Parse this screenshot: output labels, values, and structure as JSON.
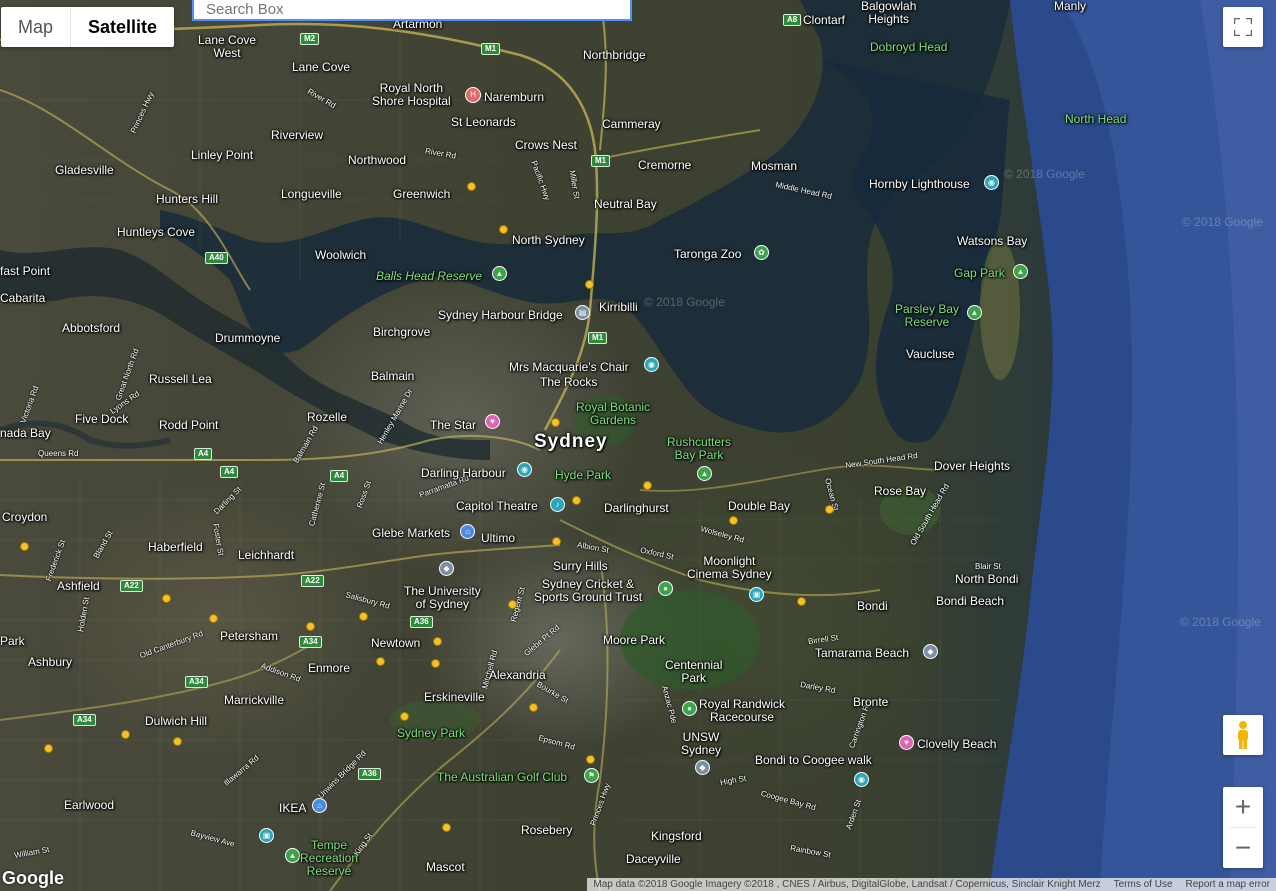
{
  "search": {
    "placeholder": "Search Box"
  },
  "map_type": {
    "options": [
      "Map",
      "Satellite"
    ],
    "selected": "Satellite"
  },
  "controls": {
    "fullscreen_icon": "fullscreen-icon",
    "pegman_icon": "pegman-icon",
    "zoom_in": "+",
    "zoom_out": "−"
  },
  "branding": {
    "logo": "Google"
  },
  "attribution": {
    "map_data": "Map data ©2018 Google Imagery ©2018 , CNES / Airbus, DigitalGlobe, Landsat / Copernicus, Sinclair Knight Merz",
    "terms": "Terms of Use",
    "report": "Report a map error"
  },
  "watermarks": [
    "© 2018 Google",
    "© 2018 Google",
    "© 2018 Google",
    "© 2018 Google"
  ],
  "places": {
    "sydney": "Sydney",
    "artarmon": "Artarmon",
    "lane_cove_west": "Lane Cove\nWest",
    "lane_cove": "Lane Cove",
    "royal_north_shore": "Royal North\nShore Hospital",
    "naremburn": "Naremburn",
    "northbridge": "Northbridge",
    "balgowlah_heights": "Balgowlah\nHeights",
    "clontarf": "Clontarf",
    "manly": "Manly",
    "dobroyd_head": "Dobroyd Head",
    "north_head": "North Head",
    "gladesville": "Gladesville",
    "riverview": "Riverview",
    "linley_point": "Linley Point",
    "st_leonards": "St Leonards",
    "crows_nest": "Crows Nest",
    "cammeray": "Cammeray",
    "cremorne": "Cremorne",
    "mosman": "Mosman",
    "northwood": "Northwood",
    "hunters_hill": "Hunters Hill",
    "longueville": "Longueville",
    "greenwich": "Greenwich",
    "neutral_bay": "Neutral Bay",
    "hornby_lighthouse": "Hornby Lighthouse",
    "huntleys_cove": "Huntleys Cove",
    "north_sydney": "North Sydney",
    "taronga_zoo": "Taronga Zoo",
    "watsons_bay": "Watsons Bay",
    "woolwich": "Woolwich",
    "balls_head": "Balls Head Reserve",
    "gap_park": "Gap Park",
    "fast_point": "fast Point",
    "cabarita": "Cabarita",
    "abbotsford": "Abbotsford",
    "sydney_harbour_bridge": "Sydney Harbour Bridge",
    "kirribilli": "Kirribilli",
    "parsley_bay": "Parsley Bay\nReserve",
    "drummoyne": "Drummoyne",
    "birchgrove": "Birchgrove",
    "vaucluse": "Vaucluse",
    "russell_lea": "Russell Lea",
    "balmain": "Balmain",
    "mrs_macquaries": "Mrs Macquarie's Chair",
    "the_rocks": "The Rocks",
    "five_dock": "Five Dock",
    "royal_botanic": "Royal Botanic\nGardens",
    "rozelle": "Rozelle",
    "rodd_point": "Rodd Point",
    "the_star": "The Star",
    "canada_bay": "nada Bay",
    "rushcutters": "Rushcutters\nBay Park",
    "dover_heights": "Dover Heights",
    "darling_harbour": "Darling Harbour",
    "hyde_park": "Hyde Park",
    "rose_bay": "Rose Bay",
    "capitol_theatre": "Capitol Theatre",
    "darlinghurst": "Darlinghurst",
    "double_bay": "Double Bay",
    "croydon": "Croydon",
    "haberfield": "Haberfield",
    "glebe_markets": "Glebe Markets",
    "ultimo": "Ultimo",
    "leichhardt": "Leichhardt",
    "moonlight_cinema": "Moonlight\nCinema Sydney",
    "surry_hills": "Surry Hills",
    "north_bondi": "North Bondi",
    "sydney_cricket": "Sydney Cricket &\nSports Ground Trust",
    "ashfield": "Ashfield",
    "university_sydney": "The University\nof Sydney",
    "bondi": "Bondi",
    "bondi_beach": "Bondi Beach",
    "park": "Park",
    "petersham": "Petersham",
    "newtown": "Newtown",
    "moore_park": "Moore Park",
    "tamarama": "Tamarama Beach",
    "ashbury": "Ashbury",
    "enmore": "Enmore",
    "centennial_park": "Centennial\nPark",
    "alexandria": "Alexandria",
    "marrickville": "Marrickville",
    "erskineville": "Erskineville",
    "royal_randwick": "Royal Randwick\nRacecourse",
    "bronte": "Bronte",
    "dulwich_hill": "Dulwich Hill",
    "unsw": "UNSW\nSydney",
    "sydney_park": "Sydney Park",
    "clovelly": "Clovelly Beach",
    "bondi_coogee": "Bondi to Coogee walk",
    "golf_club": "The Australian Golf Club",
    "earlwood": "Earlwood",
    "ikea": "IKEA",
    "rosebery": "Rosebery",
    "kingsford": "Kingsford",
    "tempe": "Tempe\nRecreation\nReserve",
    "mascot": "Mascot",
    "daceyville": "Daceyville"
  },
  "roads": {
    "m2": "M2",
    "m1a": "M1",
    "m1b": "M1",
    "m1c": "M1",
    "a8": "A8",
    "a40": "A40",
    "a4a": "A4",
    "a4b": "A4",
    "a4c": "A4",
    "a22a": "A22",
    "a22b": "A22",
    "a36a": "A36",
    "a36b": "A36",
    "a34a": "A34",
    "a34b": "A34",
    "a34c": "A34",
    "princes_hwy": "Princes Hwy",
    "river_rd": "River Rd",
    "pacific_hwy": "Pacific Hwy",
    "military_rd": "Military Rd",
    "middle_head_rd": "Middle Head Rd",
    "new_south_head_rd": "New South Head Rd",
    "old_south_head_rd": "Old South Head Rd",
    "oxford_st": "Oxford St",
    "parramatta_rd": "Parramatta Rd",
    "canterbury_rd": "Old Canterbury Rd",
    "king_st": "King St",
    "anzac_pde": "Anzac Pde",
    "botany_rd": "Bourke St",
    "victoria_rd": "Victoria Rd",
    "lyons_rd": "Lyons Rd",
    "great_north_rd": "Great North Rd",
    "queens_rd": "Queens Rd",
    "darley_rd": "Darley Rd",
    "high_st": "High St",
    "coogee_bay_rd": "Coogee Bay Rd",
    "epsom_rd": "Epsom Rd",
    "salisbury_rd": "Salisbury Rd",
    "illawarra_rd": "Illawarra Rd",
    "bayview_ave": "Bayview Ave",
    "unwins_bridge_rd": "Unwins Bridge Rd",
    "birrell_st": "Birrell St",
    "blair_st": "Blair St",
    "carrington_rd": "Carrington Rd",
    "rainbow_st": "Rainbow St",
    "william_st": "William St",
    "addison_rd": "Addison Rd",
    "albion_st": "Albion St",
    "regent_st": "Regent St",
    "mitchell_rd": "Mitchell Rd",
    "henley_marine": "Henley Marine Dr",
    "catherine_st": "Catherine St",
    "balmain_rd": "Balmain Rd",
    "foster_st": "Foster St",
    "bland_st": "Bland St",
    "frederick_st": "Frederick St",
    "holden_st": "Holden St",
    "miller_st": "Miller St",
    "darling_st": "Darling St",
    "ross_st": "Ross St",
    "glebe_pt_rd": "Glebe Pt Rd",
    "ocean_st": "Ocean St",
    "princes_hwy2": "Princes Hwy",
    "wolseley_rd": "Wolseley Rd",
    "arden_st": "Arden St"
  }
}
